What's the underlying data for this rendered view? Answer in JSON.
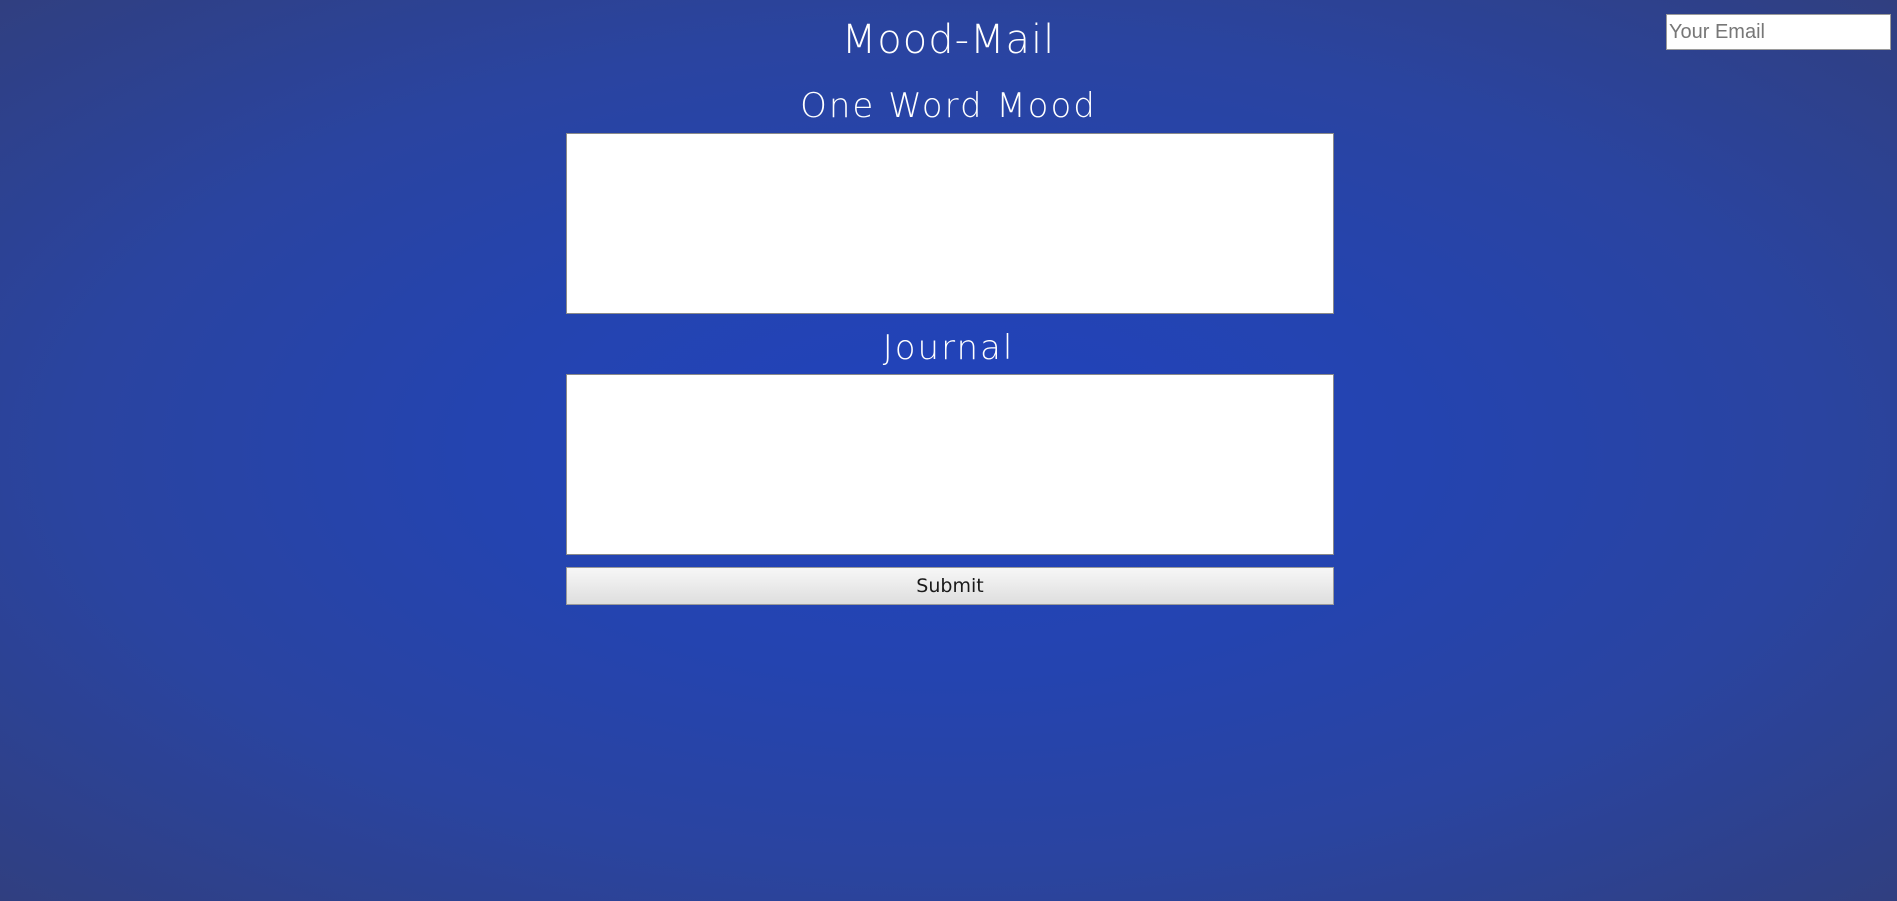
{
  "header": {
    "title": "Mood-Mail",
    "email_placeholder": "Your Email"
  },
  "form": {
    "mood_label": "One Word Mood",
    "mood_value": "",
    "journal_label": "Journal",
    "journal_value": "",
    "submit_label": "Submit"
  }
}
